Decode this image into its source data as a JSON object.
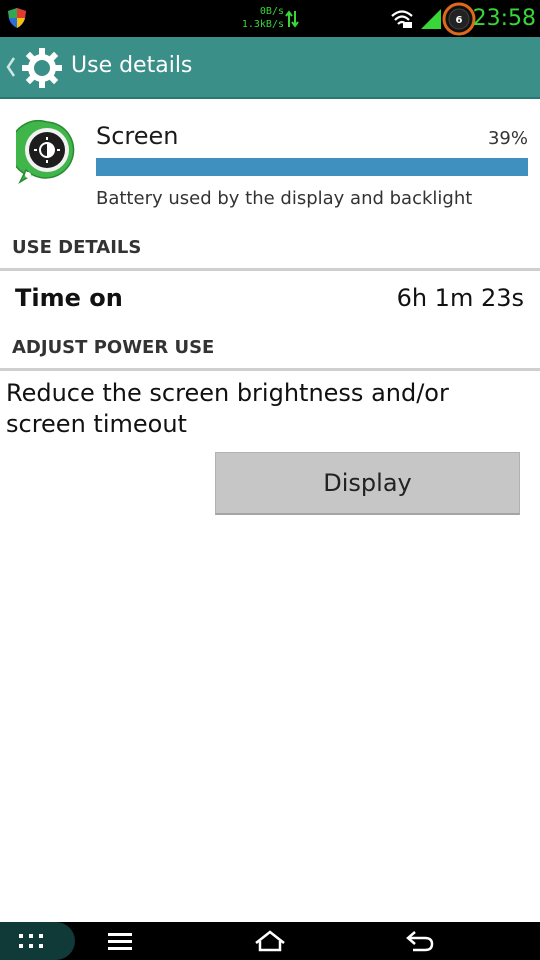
{
  "status_bar": {
    "net_down": "0B/s",
    "net_up": "1.3kB/s",
    "notification_count": "6",
    "time": "23:58"
  },
  "action_bar": {
    "title": "Use details"
  },
  "app": {
    "name": "Screen",
    "percent": "39%",
    "usage_fraction": 1.0,
    "summary": "Battery used by the display and backlight"
  },
  "sections": {
    "use_details": "USE DETAILS",
    "adjust_power": "ADJUST POWER USE"
  },
  "time_on": {
    "label": "Time on",
    "value": "6h 1m 23s"
  },
  "advice": "Reduce the screen brightness and/or screen timeout",
  "display_button": "Display",
  "colors": {
    "accent": "#3a9089",
    "bar": "#3f8fbf",
    "status_text": "#39d639"
  }
}
